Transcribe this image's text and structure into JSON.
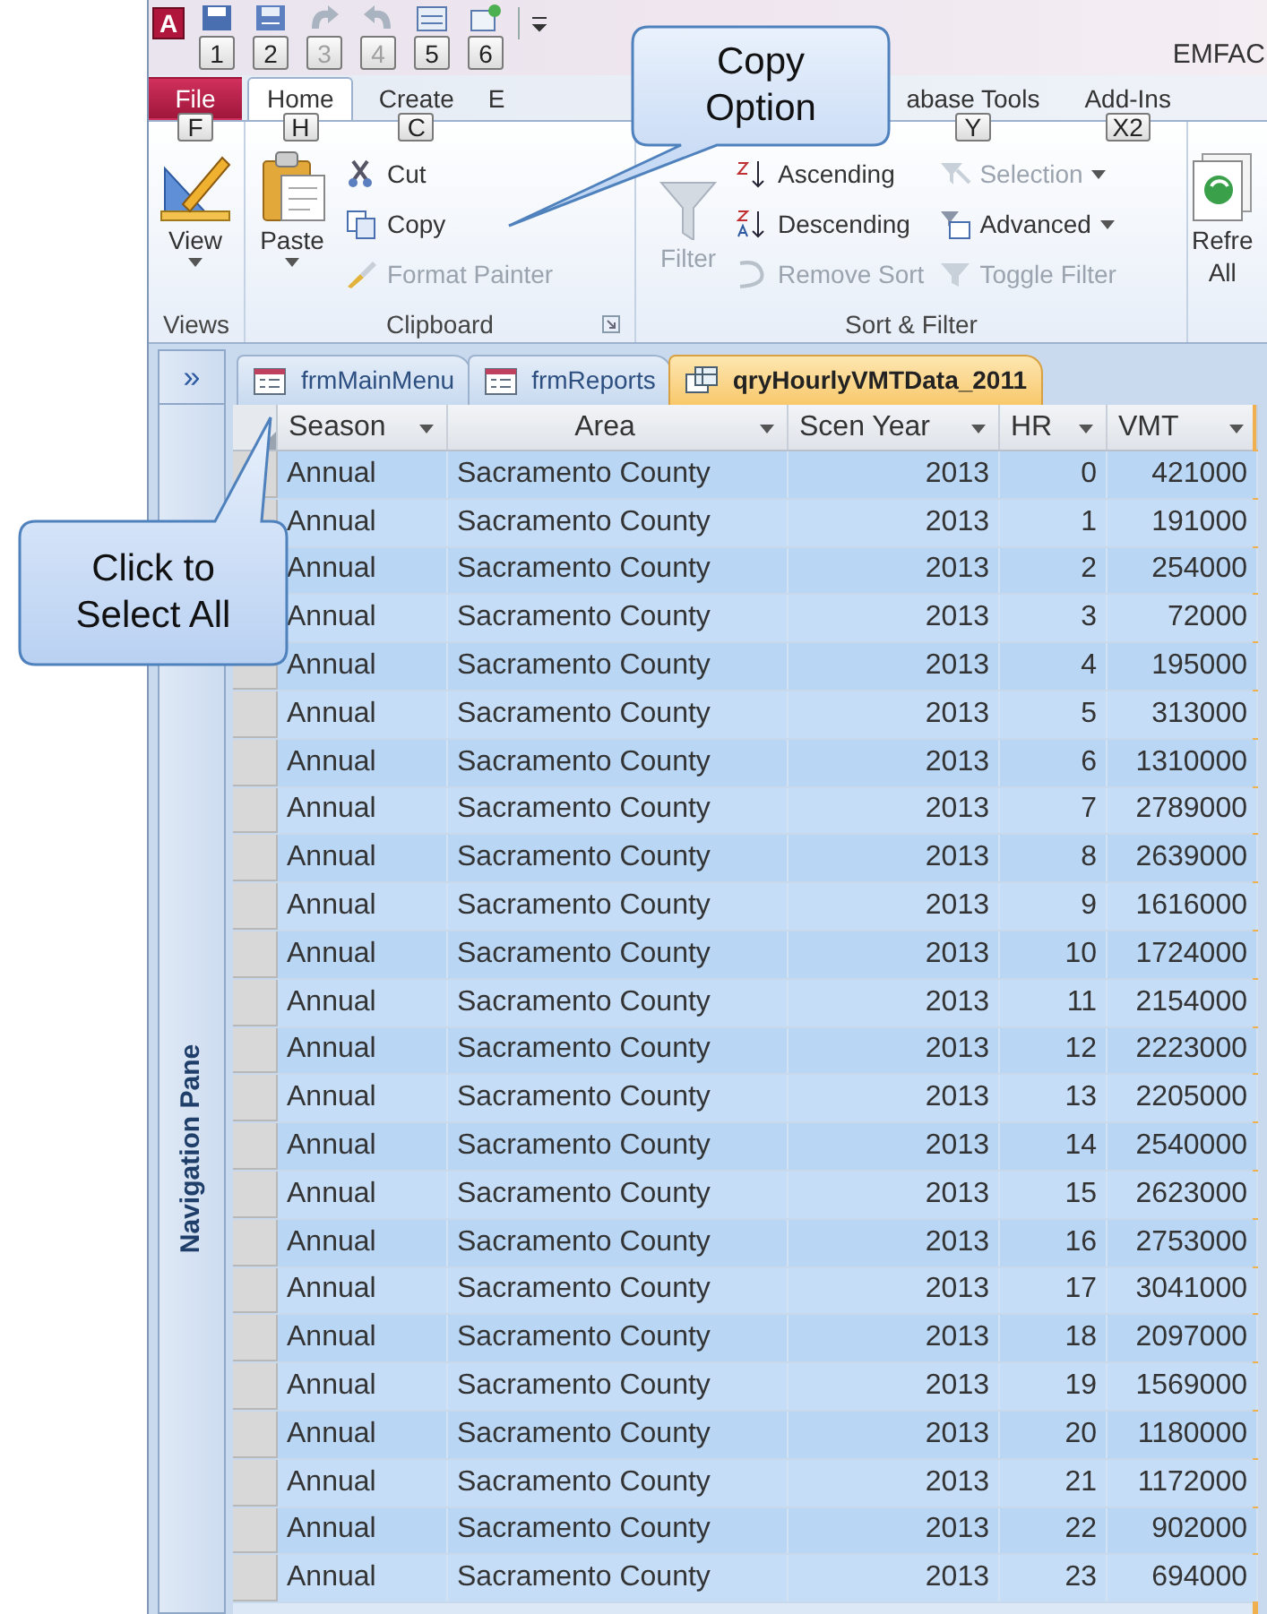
{
  "window": {
    "app_letter": "A",
    "title": "EMFAC"
  },
  "quick_access": [
    {
      "keytip": "1",
      "disabled": false
    },
    {
      "keytip": "2",
      "disabled": false
    },
    {
      "keytip": "3",
      "disabled": true
    },
    {
      "keytip": "4",
      "disabled": true
    },
    {
      "keytip": "5",
      "disabled": false
    },
    {
      "keytip": "6",
      "disabled": false
    }
  ],
  "ribbon_tabs": [
    {
      "label": "File",
      "keytip": "F",
      "selected": false,
      "kind": "file"
    },
    {
      "label": "Home",
      "keytip": "H",
      "selected": true,
      "kind": "normal"
    },
    {
      "label": "Create",
      "keytip": "C",
      "selected": false,
      "kind": "normal"
    },
    {
      "label": "E",
      "selected": false,
      "kind": "covered"
    },
    {
      "label": "abase Tools",
      "keytip": "Y",
      "selected": false,
      "kind": "normal"
    },
    {
      "label": "Add-Ins",
      "keytip": "X2",
      "selected": false,
      "kind": "normal"
    }
  ],
  "ribbon_groups": [
    {
      "label": "Views",
      "launcher": false,
      "large": [
        {
          "label": "View",
          "dropdown": true,
          "disabled": false
        }
      ]
    },
    {
      "label": "Clipboard",
      "launcher": true,
      "large": [
        {
          "label": "Paste",
          "dropdown": true,
          "disabled": false
        }
      ],
      "columns": [
        [
          {
            "label": "Cut",
            "disabled": false,
            "dropdown": false
          },
          {
            "label": "Copy",
            "disabled": false,
            "dropdown": false
          },
          {
            "label": "Format Painter",
            "disabled": true,
            "dropdown": false
          }
        ]
      ]
    },
    {
      "label": "Sort & Filter",
      "launcher": false,
      "large": [
        {
          "label": "Filter",
          "dropdown": false,
          "disabled": true
        }
      ],
      "columns": [
        [
          {
            "label": "Ascending",
            "disabled": false,
            "dropdown": false
          },
          {
            "label": "Descending",
            "disabled": false,
            "dropdown": false
          },
          {
            "label": "Remove Sort",
            "disabled": true,
            "dropdown": false
          }
        ],
        [
          {
            "label": "Selection",
            "disabled": true,
            "dropdown": true
          },
          {
            "label": "Advanced",
            "disabled": false,
            "dropdown": true
          },
          {
            "label": "Toggle Filter",
            "disabled": true,
            "dropdown": false
          }
        ]
      ]
    },
    {
      "launcher": false,
      "large": [
        {
          "label": "Refre\nAll",
          "dropdown": false,
          "disabled": false
        }
      ]
    }
  ],
  "navigation_pane": {
    "toggle": "»",
    "label": "Navigation Pane"
  },
  "document_tabs": [
    {
      "label": "frmMainMenu",
      "selected": false,
      "kind": "form"
    },
    {
      "label": "frmReports",
      "selected": false,
      "kind": "form"
    },
    {
      "label": "qryHourlyVMTData_2011",
      "selected": true,
      "kind": "query"
    }
  ],
  "table": {
    "columns": [
      "Season",
      "Area",
      "Scen Year",
      "HR",
      "VMT"
    ],
    "rows": [
      {
        "cells": [
          "Annual",
          "Sacramento County",
          "2013",
          "0",
          "421000"
        ],
        "selected": true
      },
      {
        "cells": [
          "Annual",
          "Sacramento County",
          "2013",
          "1",
          "191000"
        ],
        "selected": true
      },
      {
        "cells": [
          "Annual",
          "Sacramento County",
          "2013",
          "2",
          "254000"
        ],
        "selected": true
      },
      {
        "cells": [
          "Annual",
          "Sacramento County",
          "2013",
          "3",
          "72000"
        ],
        "selected": true
      },
      {
        "cells": [
          "Annual",
          "Sacramento County",
          "2013",
          "4",
          "195000"
        ],
        "selected": true
      },
      {
        "cells": [
          "Annual",
          "Sacramento County",
          "2013",
          "5",
          "313000"
        ],
        "selected": true
      },
      {
        "cells": [
          "Annual",
          "Sacramento County",
          "2013",
          "6",
          "1310000"
        ],
        "selected": true
      },
      {
        "cells": [
          "Annual",
          "Sacramento County",
          "2013",
          "7",
          "2789000"
        ],
        "selected": true
      },
      {
        "cells": [
          "Annual",
          "Sacramento County",
          "2013",
          "8",
          "2639000"
        ],
        "selected": true
      },
      {
        "cells": [
          "Annual",
          "Sacramento County",
          "2013",
          "9",
          "1616000"
        ],
        "selected": true
      },
      {
        "cells": [
          "Annual",
          "Sacramento County",
          "2013",
          "10",
          "1724000"
        ],
        "selected": true
      },
      {
        "cells": [
          "Annual",
          "Sacramento County",
          "2013",
          "11",
          "2154000"
        ],
        "selected": true
      },
      {
        "cells": [
          "Annual",
          "Sacramento County",
          "2013",
          "12",
          "2223000"
        ],
        "selected": true
      },
      {
        "cells": [
          "Annual",
          "Sacramento County",
          "2013",
          "13",
          "2205000"
        ],
        "selected": true
      },
      {
        "cells": [
          "Annual",
          "Sacramento County",
          "2013",
          "14",
          "2540000"
        ],
        "selected": true
      },
      {
        "cells": [
          "Annual",
          "Sacramento County",
          "2013",
          "15",
          "2623000"
        ],
        "selected": true
      },
      {
        "cells": [
          "Annual",
          "Sacramento County",
          "2013",
          "16",
          "2753000"
        ],
        "selected": true
      },
      {
        "cells": [
          "Annual",
          "Sacramento County",
          "2013",
          "17",
          "3041000"
        ],
        "selected": true
      },
      {
        "cells": [
          "Annual",
          "Sacramento County",
          "2013",
          "18",
          "2097000"
        ],
        "selected": true
      },
      {
        "cells": [
          "Annual",
          "Sacramento County",
          "2013",
          "19",
          "1569000"
        ],
        "selected": true
      },
      {
        "cells": [
          "Annual",
          "Sacramento County",
          "2013",
          "20",
          "1180000"
        ],
        "selected": true
      },
      {
        "cells": [
          "Annual",
          "Sacramento County",
          "2013",
          "21",
          "1172000"
        ],
        "selected": true
      },
      {
        "cells": [
          "Annual",
          "Sacramento County",
          "2013",
          "22",
          "902000"
        ],
        "selected": true
      },
      {
        "cells": [
          "Annual",
          "Sacramento County",
          "2013",
          "23",
          "694000"
        ],
        "selected": true
      }
    ]
  },
  "callouts": [
    {
      "text": "Copy Option",
      "kind": "down-left"
    },
    {
      "text": "Click to Select All",
      "kind": "up"
    }
  ]
}
